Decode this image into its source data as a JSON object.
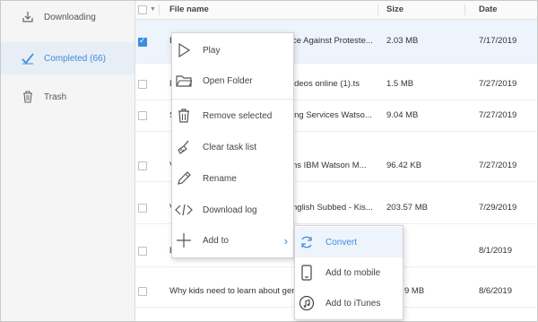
{
  "sidebar": {
    "items": [
      {
        "label": "Downloading",
        "icon": "download-icon"
      },
      {
        "label": "Completed (66)",
        "icon": "check-icon"
      },
      {
        "label": "Trash",
        "icon": "trash-icon"
      }
    ]
  },
  "table": {
    "columns": {
      "filename": "File name",
      "size": "Size",
      "date": "Date"
    },
    "rows": [
      {
        "name_left": "E",
        "name_right": "ce Against Proteste...",
        "size": "2.03 MB",
        "date": "7/17/2019",
        "checked": true
      },
      {
        "name_left": "D",
        "name_right": "ideos online (1).ts",
        "size": "1.5 MB",
        "date": "7/27/2019",
        "checked": false
      },
      {
        "name_left": "S",
        "name_right": "ing Services  Watso...",
        "size": "9.04 MB",
        "date": "7/27/2019",
        "checked": false
      },
      {
        "name_left": "V",
        "name_right": "ns  IBM Watson M...",
        "size": "96.42 KB",
        "date": "7/27/2019",
        "checked": false
      },
      {
        "name_left": "V",
        "name_right": "nglish Subbed - Kis...",
        "size": "203.57 MB",
        "date": "7/29/2019",
        "checked": false
      },
      {
        "name_left": "E",
        "name_right": "",
        "size": "",
        "date": "8/1/2019",
        "checked": false
      },
      {
        "name_left": "Why kids need to learn about gend",
        "name_right": "",
        "size": "9 MB",
        "date": "8/6/2019",
        "checked": false
      }
    ]
  },
  "context_menu": {
    "items": [
      {
        "label": "Play",
        "icon": "play-icon"
      },
      {
        "label": "Open Folder",
        "icon": "folder-icon"
      },
      {
        "label": "Remove selected",
        "icon": "trash-icon"
      },
      {
        "label": "Clear task list",
        "icon": "broom-icon"
      },
      {
        "label": "Rename",
        "icon": "pencil-icon"
      },
      {
        "label": "Download log",
        "icon": "code-icon"
      },
      {
        "label": "Add to",
        "icon": "plus-icon"
      }
    ],
    "submenu_arrow": "›"
  },
  "submenu": {
    "items": [
      {
        "label": "Convert",
        "icon": "convert-icon"
      },
      {
        "label": "Add to mobile",
        "icon": "mobile-icon"
      },
      {
        "label": "Add to iTunes",
        "icon": "itunes-icon"
      }
    ]
  },
  "colors": {
    "accent": "#3b8de0",
    "sidebar_bg": "#f5f5f5",
    "selected_bg": "#eef4fb"
  }
}
